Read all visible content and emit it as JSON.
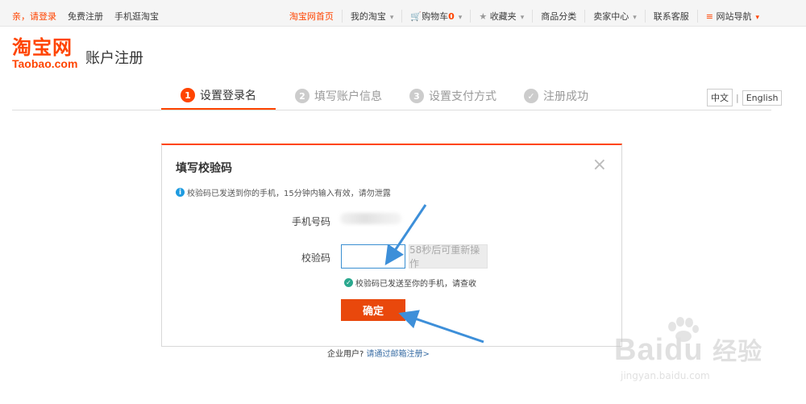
{
  "topbar": {
    "login": "亲，请登录",
    "register": "免费注册",
    "mobile": "手机逛淘宝",
    "home": "淘宝网首页",
    "my_taobao": "我的淘宝",
    "cart": "购物车",
    "cart_count": "0",
    "favorites": "收藏夹",
    "categories": "商品分类",
    "seller": "卖家中心",
    "service": "联系客服",
    "site_nav": "网站导航"
  },
  "logo": {
    "cn": "淘宝网",
    "en": "Taobao.com"
  },
  "page_title": "账户注册",
  "steps": [
    {
      "num": "1",
      "label": "设置登录名",
      "active": true
    },
    {
      "num": "2",
      "label": "填写账户信息",
      "active": false
    },
    {
      "num": "3",
      "label": "设置支付方式",
      "active": false
    },
    {
      "num": "✓",
      "label": "注册成功",
      "active": false
    }
  ],
  "lang": {
    "zh": "中文",
    "sep": "|",
    "en": "English"
  },
  "dialog": {
    "title": "填写校验码",
    "close": "×",
    "notice": "校验码已发送到你的手机，15分钟内输入有效，请勿泄露",
    "phone_label": "手机号码",
    "code_label": "校验码",
    "code_value": "",
    "resend": "58秒后可重新操作",
    "sent_msg": "校验码已发送至你的手机，请查收",
    "confirm": "确定"
  },
  "footer": {
    "question": "企业用户?",
    "link": "请通过邮箱注册>"
  },
  "watermark": {
    "brand": "Bai",
    "brand2": "du",
    "brand_cn": "经验",
    "url": "jingyan.baidu.com"
  },
  "colors": {
    "accent": "#ff4400",
    "button": "#e9480c",
    "arrow": "#3d8fd9"
  }
}
